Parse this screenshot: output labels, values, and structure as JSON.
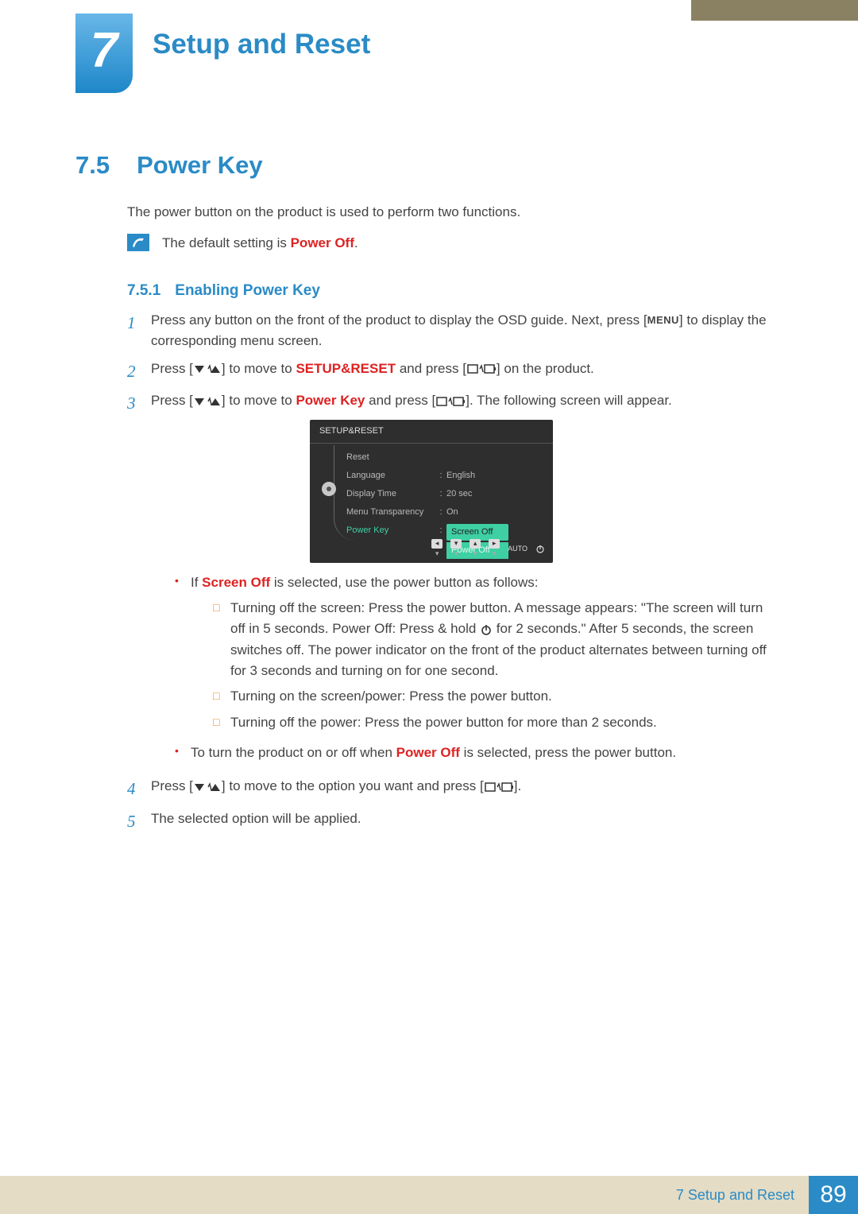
{
  "header": {
    "chapter_number": "7",
    "chapter_title": "Setup and Reset"
  },
  "section": {
    "number": "7.5",
    "title": "Power Key",
    "intro": "The power button on the product is used to perform two functions.",
    "note_prefix": "The default setting is ",
    "note_bold": "Power Off",
    "note_suffix": "."
  },
  "subsection": {
    "number": "7.5.1",
    "title": "Enabling Power Key"
  },
  "steps": {
    "s1_a": "Press any button on the front of the product to display the OSD guide. Next, press [",
    "s1_menu": "MENU",
    "s1_b": "] to display the corresponding menu screen.",
    "s2_a": "Press [",
    "s2_mid": "] to move to ",
    "s2_red": "SETUP&RESET",
    "s2_b": " and press [",
    "s2_c": "] on the product.",
    "s3_a": "Press [",
    "s3_mid": "] to move to ",
    "s3_red": "Power Key",
    "s3_b": " and press [",
    "s3_c": "]. The following screen will appear.",
    "s4_a": "Press [",
    "s4_mid": "] to move to the option you want and press [",
    "s4_c": "].",
    "s5": "The selected option will be applied."
  },
  "osd": {
    "title": "SETUP&RESET",
    "items": [
      {
        "label": "Reset",
        "value": ""
      },
      {
        "label": "Language",
        "value": "English"
      },
      {
        "label": "Display Time",
        "value": "20 sec"
      },
      {
        "label": "Menu Transparency",
        "value": "On"
      },
      {
        "label": "Power Key",
        "value": "Screen Off"
      }
    ],
    "dropdown_other": "Power Off",
    "auto": "AUTO"
  },
  "bullets": {
    "b1_a": "If ",
    "b1_red": "Screen Off",
    "b1_b": " is selected, use the power button as follows:",
    "sub": {
      "i1_a": "Turning off the screen: Press the power button. A message appears: \"The screen will turn off in 5 seconds. Power Off: Press & hold ",
      "i1_b": " for 2 seconds.\" After 5 seconds, the screen switches off. The power indicator on the front of the product alternates between turning off for 3 seconds and turning on for one second.",
      "i2": "Turning on the screen/power: Press the power button.",
      "i3": "Turning off the power: Press the power button for more than 2 seconds."
    },
    "b2_a": "To turn the product on or off when ",
    "b2_red": "Power Off",
    "b2_b": " is selected, press the power button."
  },
  "footer": {
    "chapter_ref": "7 Setup and Reset",
    "page": "89"
  }
}
